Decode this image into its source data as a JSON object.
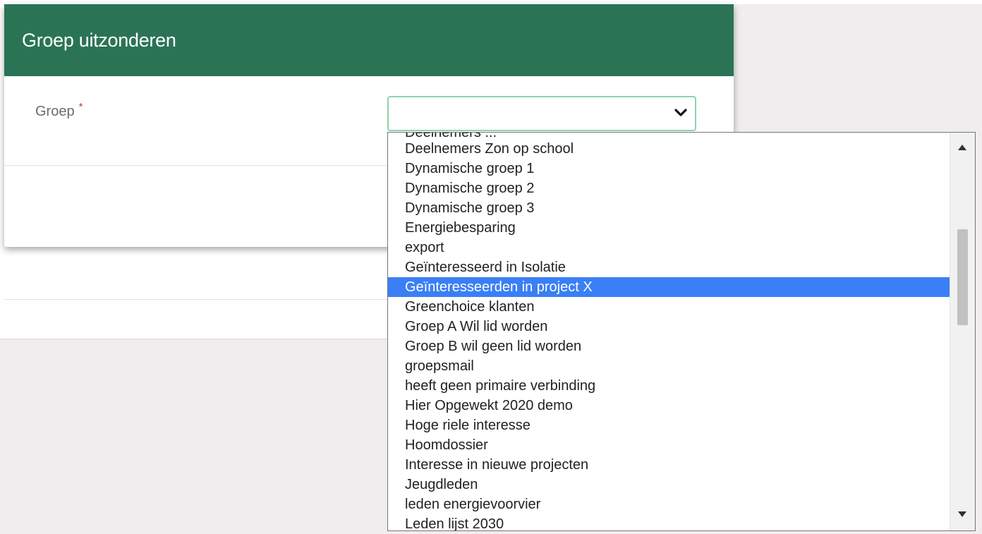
{
  "modal": {
    "title": "Groep uitzonderen",
    "field_label": "Groep",
    "required_marker": "*",
    "select_value": ""
  },
  "dropdown": {
    "partial_top_option": "Deelnemers ...",
    "options": [
      "Deelnemers Zon op school",
      "Dynamische groep 1",
      "Dynamische groep 2",
      "Dynamische groep 3",
      "Energiebesparing",
      "export",
      "Geïnteresseerd in Isolatie",
      "Geïnteresseerden in project X",
      "Greenchoice klanten",
      "Groep A Wil lid worden",
      "Groep B wil geen lid worden",
      "groepsmail",
      "heeft geen primaire verbinding",
      "Hier Opgewekt 2020 demo",
      "Hoge riele interesse",
      "Hoomdossier",
      "Interesse in nieuwe projecten",
      "Jeugdleden",
      "leden energievoorvier",
      "Leden lijst 2030"
    ],
    "selected_index": 7
  },
  "colors": {
    "header_green": "#2a7455",
    "focus_border": "#8fd2ad",
    "selected_blue": "#3a7ff5",
    "required_red": "#d33a2c"
  },
  "icons": {
    "select_chevron": "chevron-down-icon",
    "scroll_up": "scroll-up-arrow-icon",
    "scroll_down": "scroll-down-arrow-icon"
  }
}
